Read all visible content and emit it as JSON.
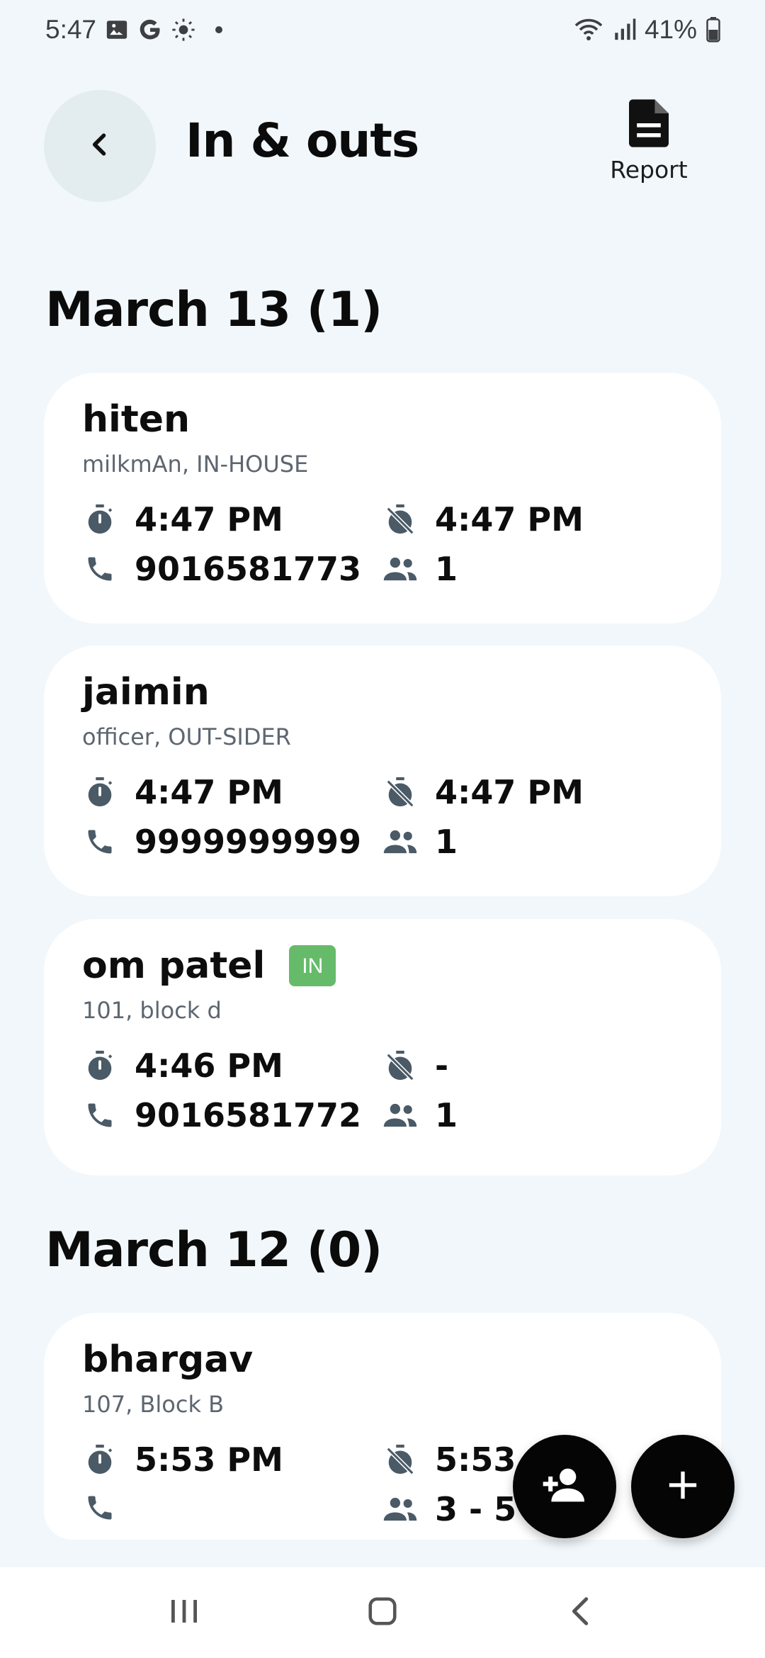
{
  "status_bar": {
    "time": "5:47",
    "battery": "41%",
    "icons": [
      "gallery-icon",
      "google-icon",
      "brightness-icon",
      "wifi-icon",
      "signal-icon",
      "battery-icon"
    ]
  },
  "header": {
    "title": "In & outs",
    "back_icon": "chevron-left-icon",
    "report_label": "Report",
    "report_icon": "document-icon"
  },
  "sections": [
    {
      "heading": "March 13 (1)",
      "entries": [
        {
          "name": "hiten",
          "subtitle": "milkmAn, IN-HOUSE",
          "in_time": "4:47 PM",
          "out_time": "4:47 PM",
          "phone": "9016581773",
          "people": "1",
          "badge": ""
        },
        {
          "name": "jaimin",
          "subtitle": "officer, OUT-SIDER",
          "in_time": "4:47 PM",
          "out_time": "4:47 PM",
          "phone": "9999999999",
          "people": "1",
          "badge": ""
        },
        {
          "name": "om patel",
          "subtitle": "101, block d",
          "in_time": "4:46 PM",
          "out_time": "-",
          "phone": "9016581772",
          "people": "1",
          "badge": "IN"
        }
      ]
    },
    {
      "heading": "March 12 (0)",
      "entries": [
        {
          "name": "bhargav",
          "subtitle": "107, Block B",
          "in_time": "5:53 PM",
          "out_time": "5:53",
          "phone": "",
          "people": "3 - 5",
          "badge": ""
        }
      ]
    }
  ],
  "fabs": {
    "add_person_icon": "person-add-icon",
    "add_icon": "plus-icon"
  },
  "colors": {
    "background": "#f1f7fb",
    "card": "#ffffff",
    "icon": "#4a5a66",
    "badge_in": "#66bb6a",
    "fab": "#050505"
  }
}
